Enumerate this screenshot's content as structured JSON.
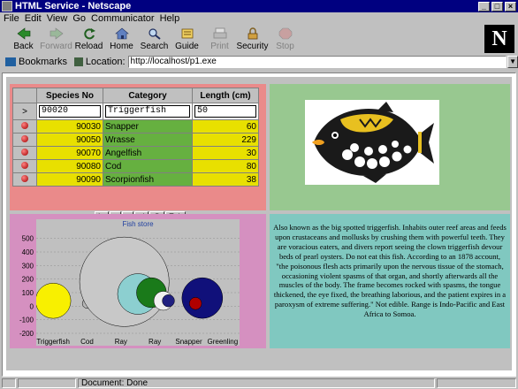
{
  "window": {
    "title": "HTML Service - Netscape"
  },
  "menu": [
    "File",
    "Edit",
    "View",
    "Go",
    "Communicator",
    "Help"
  ],
  "toolbar": [
    {
      "label": "Back",
      "icon": "back-arrow-icon",
      "enabled": true
    },
    {
      "label": "Forward",
      "icon": "forward-arrow-icon",
      "enabled": false
    },
    {
      "label": "Reload",
      "icon": "reload-icon",
      "enabled": true
    },
    {
      "label": "Home",
      "icon": "home-icon",
      "enabled": true
    },
    {
      "label": "Search",
      "icon": "search-icon",
      "enabled": true
    },
    {
      "label": "Guide",
      "icon": "guide-icon",
      "enabled": true
    },
    {
      "label": "Print",
      "icon": "print-icon",
      "enabled": false
    },
    {
      "label": "Security",
      "icon": "security-lock-icon",
      "enabled": true
    },
    {
      "label": "Stop",
      "icon": "stop-icon",
      "enabled": false
    }
  ],
  "logo": "N",
  "location": {
    "bookmarks": "Bookmarks",
    "label": "Location:",
    "url": "http://localhost/p1.exe"
  },
  "grid": {
    "headers": [
      "Species No",
      "Category",
      "Length (cm)"
    ],
    "edit_marker": ">",
    "edit_row": {
      "species_no": "90020",
      "category": "Triggerfish",
      "length": "50"
    },
    "rows": [
      {
        "species_no": "90030",
        "category": "Snapper",
        "length": "60"
      },
      {
        "species_no": "90050",
        "category": "Wrasse",
        "length": "229"
      },
      {
        "species_no": "90070",
        "category": "Angelfish",
        "length": "30"
      },
      {
        "species_no": "90080",
        "category": "Cod",
        "length": "80"
      },
      {
        "species_no": "90090",
        "category": "Scorpionfish",
        "length": "38"
      }
    ],
    "nav": [
      "|<",
      "<",
      ">",
      ">|",
      "@",
      "Exit"
    ],
    "colors": {
      "background": "#ea8a8a",
      "number": "#e8e000",
      "category": "#66b040"
    }
  },
  "chart_data": {
    "type": "scatter",
    "title": "Fish store",
    "x_labels": [
      "Triggerfish",
      "Cod",
      "Ray",
      "Ray",
      "Snapper",
      "Greenling"
    ],
    "yticks": [
      500,
      400,
      300,
      200,
      100,
      0,
      -100,
      -200
    ],
    "ylim": [
      -200,
      550
    ],
    "grid": true,
    "bubbles": [
      {
        "x": 0.5,
        "y": 40,
        "r": 130,
        "color": "#f8f000"
      },
      {
        "x": 1.5,
        "y": 20,
        "r": 35,
        "color": "#b8b8b8"
      },
      {
        "x": 2.6,
        "y": 180,
        "r": 330,
        "color": "#c8c8c8"
      },
      {
        "x": 3.0,
        "y": 90,
        "r": 150,
        "color": "#8ccfd0"
      },
      {
        "x": 3.4,
        "y": 100,
        "r": 110,
        "color": "#1a7a1a"
      },
      {
        "x": 3.75,
        "y": 40,
        "r": 70,
        "color": "#f0f0f0"
      },
      {
        "x": 3.9,
        "y": 40,
        "r": 45,
        "color": "#202080"
      },
      {
        "x": 4.9,
        "y": 60,
        "r": 150,
        "color": "#10107a"
      },
      {
        "x": 4.7,
        "y": 20,
        "r": 45,
        "color": "#b00000"
      }
    ]
  },
  "description": "Also known as the big spotted triggerfish. Inhabits outer reef areas and feeds upon crustaceans and mollusks by crushing them with powerful teeth. They are voracious eaters, and divers report seeing the clown triggerfish devour beds of pearl oysters. Do not eat this fish. According to an 1878 account, \"the poisonous flesh acts primarily upon the nervous tissue of the stomach, occasioning violent spasms of that organ, and shortly afterwards all the muscles of the body. The frame becomes rocked with spasms, the tongue thickened, the eye fixed, the breathing laborious, and the patient expires in a paroxysm of extreme suffering.\" Not edible. Range is Indo-Pacific and East Africa to Somoa.",
  "status": {
    "text": "Document: Done"
  }
}
